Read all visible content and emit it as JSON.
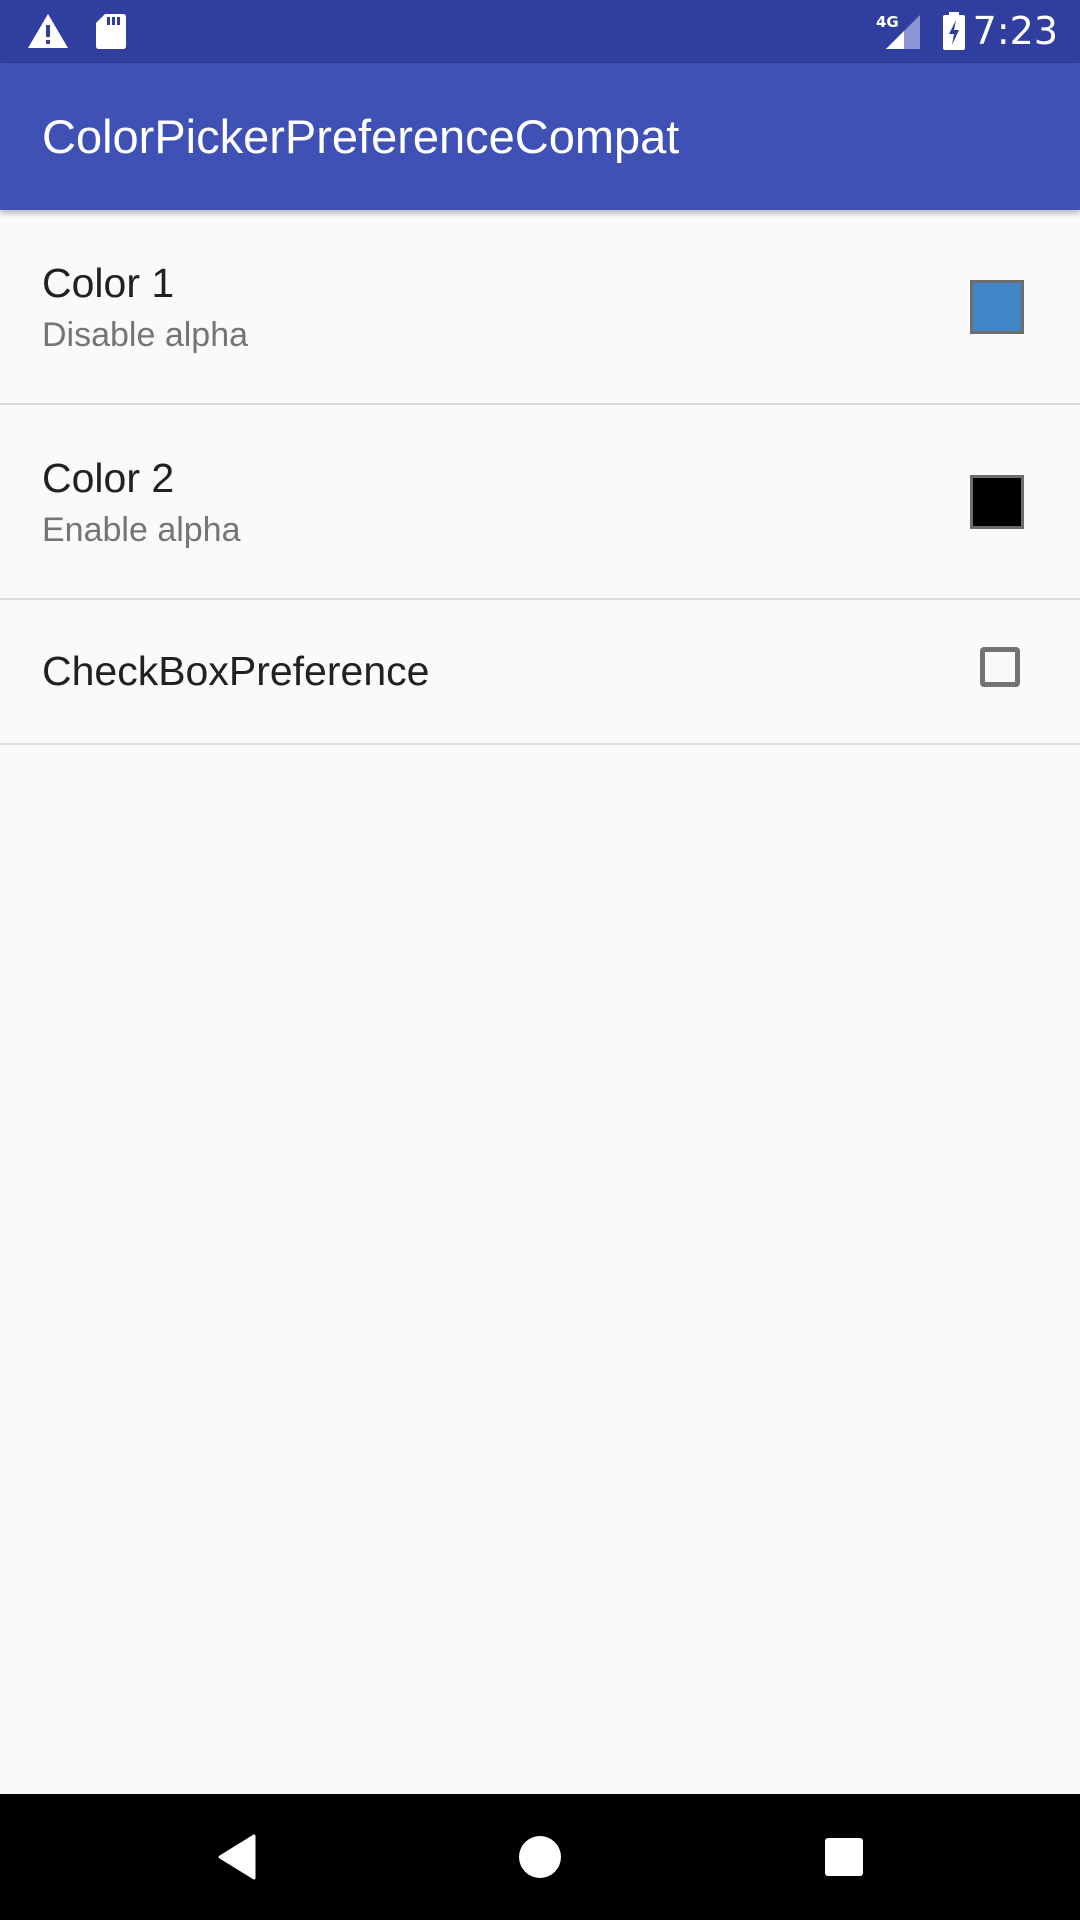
{
  "status_bar": {
    "time": "7:23",
    "network_label": "4G",
    "icons": [
      "warning-icon",
      "sd-card-icon",
      "signal-icon",
      "battery-charging-icon"
    ],
    "background": "#303f9f"
  },
  "app_bar": {
    "title": "ColorPickerPreferenceCompat",
    "background": "#3f51b5"
  },
  "preferences": [
    {
      "title": "Color 1",
      "summary": "Disable alpha",
      "widget": "color-swatch",
      "color": "#4286c8"
    },
    {
      "title": "Color 2",
      "summary": "Enable alpha",
      "widget": "color-swatch",
      "color": "#000000"
    },
    {
      "title": "CheckBoxPreference",
      "widget": "checkbox",
      "checked": false
    }
  ],
  "nav_bar": {
    "buttons": [
      "back-icon",
      "home-icon",
      "recents-icon"
    ]
  }
}
